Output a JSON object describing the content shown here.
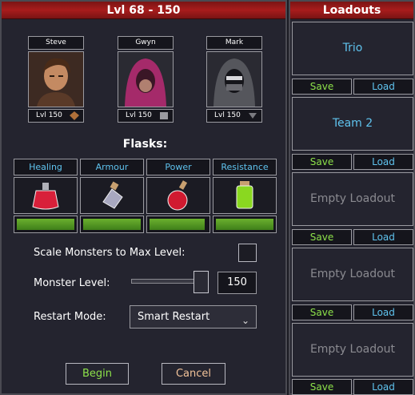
{
  "header": {
    "title": "Lvl 68 - 150"
  },
  "party": [
    {
      "name": "Steve",
      "level": "Lvl 150"
    },
    {
      "name": "Gwyn",
      "level": "Lvl 150"
    },
    {
      "name": "Mark",
      "level": "Lvl 150"
    }
  ],
  "flasks": {
    "title": "Flasks:",
    "items": [
      {
        "name": "Healing",
        "icon": "red-potion-icon",
        "fill": 1.0
      },
      {
        "name": "Armour",
        "icon": "silver-potion-icon",
        "fill": 1.0
      },
      {
        "name": "Power",
        "icon": "red-round-potion-icon",
        "fill": 0.96
      },
      {
        "name": "Resistance",
        "icon": "green-potion-icon",
        "fill": 1.0
      }
    ]
  },
  "options": {
    "scale_label": "Scale Monsters to Max Level:",
    "scale_checked": false,
    "monster_level_label": "Monster Level:",
    "monster_level": "150",
    "restart_label": "Restart Mode:",
    "restart_value": "Smart Restart"
  },
  "buttons": {
    "begin": "Begin",
    "cancel": "Cancel"
  },
  "loadouts": {
    "title": "Loadouts",
    "slots": [
      {
        "name": "Trio",
        "save": "Save",
        "load": "Load"
      },
      {
        "name": "Team 2",
        "save": "Save",
        "load": "Load"
      },
      {
        "name": "Empty Loadout",
        "save": "Save",
        "load": "Load"
      },
      {
        "name": "Empty Loadout",
        "save": "Save",
        "load": "Load"
      },
      {
        "name": "Empty Loadout",
        "save": "Save",
        "load": "Load"
      }
    ]
  }
}
